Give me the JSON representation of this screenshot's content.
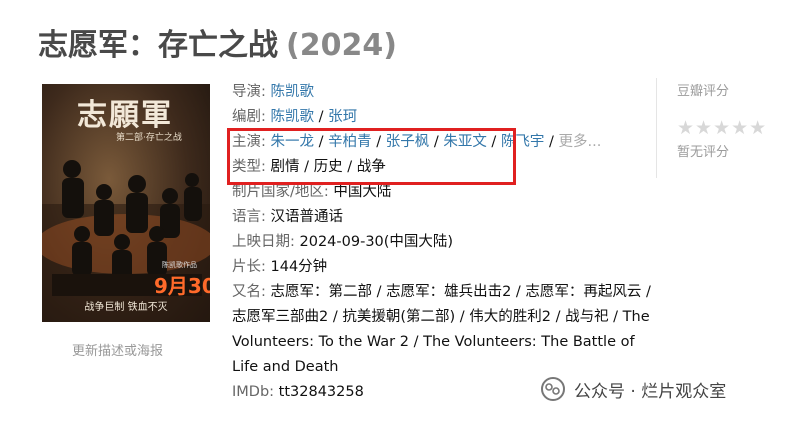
{
  "movie": {
    "title": "志愿军：存亡之战",
    "year": "(2024)"
  },
  "poster": {
    "title_art": "志願軍",
    "subtitle_art": "第二部·存亡之战",
    "date_art": "9月30日",
    "slogan_art": "战争巨制  铁血不灭",
    "credit_art": "陈凯歌作品",
    "update_link": "更新描述或海报"
  },
  "info": {
    "director_label": "导演:",
    "director": "陈凯歌",
    "writer_label": "编剧:",
    "writers": [
      "陈凯歌",
      "张珂"
    ],
    "cast_label": "主演:",
    "cast": [
      "朱一龙",
      "辛柏青",
      "张子枫",
      "朱亚文",
      "陈飞宇"
    ],
    "cast_more": "更多...",
    "genre_label": "类型:",
    "genres": [
      "剧情",
      "历史",
      "战争"
    ],
    "region_label": "制片国家/地区:",
    "region": "中国大陆",
    "language_label": "语言:",
    "language": "汉语普通话",
    "release_label": "上映日期:",
    "release": "2024-09-30(中国大陆)",
    "runtime_label": "片长:",
    "runtime": "144分钟",
    "aka_label": "又名:",
    "aka": "志愿军：第二部 / 志愿军：雄兵出击2 / 志愿军：再起风云 / 志愿军三部曲2 / 抗美援朝(第二部) / 伟大的胜利2 / 战与祀 / The Volunteers: To the War 2 / The Volunteers: The Battle of Life and Death",
    "imdb_label": "IMDb:",
    "imdb": "tt32843258"
  },
  "rating": {
    "label": "豆瓣评分",
    "stars": "★★★★★",
    "none_text": "暂无评分"
  },
  "watermark": {
    "text": "公众号 · 烂片观众室"
  }
}
